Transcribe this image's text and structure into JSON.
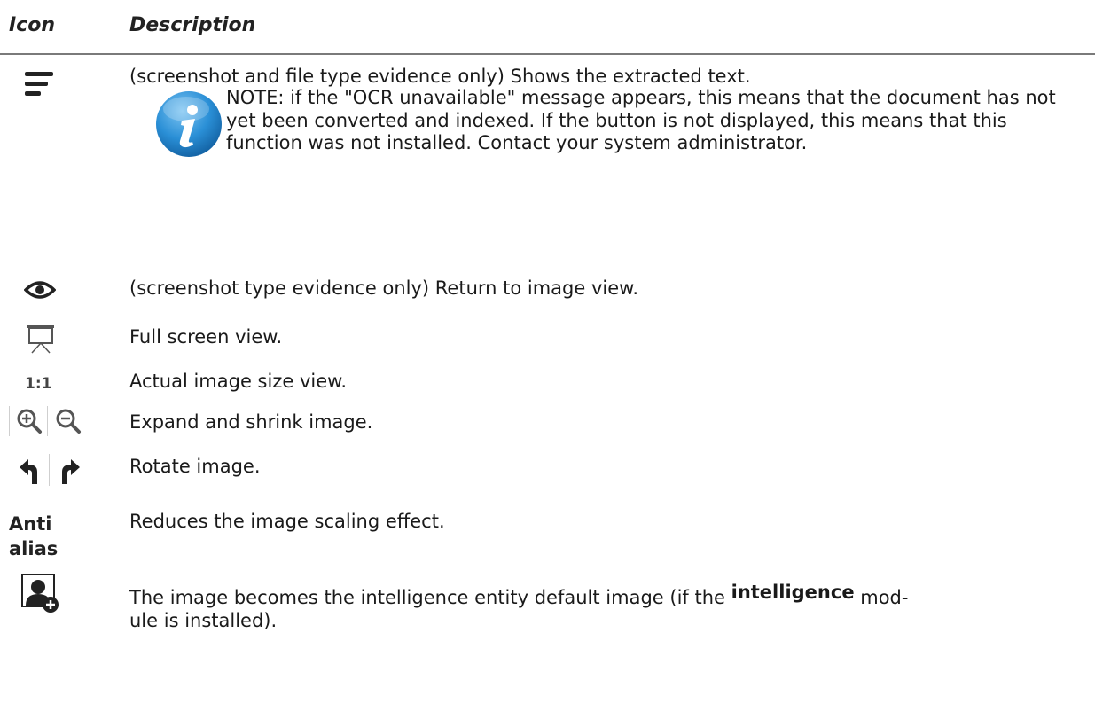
{
  "header": {
    "icon_col": "Icon",
    "desc_col": "Description"
  },
  "rows": {
    "text": {
      "icon": "text-lines-icon",
      "description": "(screenshot and file type evidence only) Shows the extracted text.",
      "note": "NOTE: if the \"OCR unavailable\" message appears, this means that the document has not yet been converted and indexed. If the button is not displayed, this means that this function was not installed. Contact your system administrator.",
      "note_icon": "info-icon"
    },
    "eye": {
      "icon": "eye-icon",
      "description": "(screenshot type evidence only) Return to image view."
    },
    "fullscreen": {
      "icon": "projector-screen-icon",
      "description": "Full screen view."
    },
    "actual": {
      "icon_text": "1:1",
      "description": "Actual image size view."
    },
    "zoom": {
      "icons": [
        "zoom-in-icon",
        "zoom-out-icon"
      ],
      "description": "Expand and shrink image."
    },
    "rotate": {
      "icons": [
        "rotate-left-icon",
        "rotate-right-icon"
      ],
      "description": "Rotate image."
    },
    "antialias": {
      "label_line1": "Anti",
      "label_line2": "alias",
      "description": "Reduces the image scaling effect."
    },
    "entity": {
      "icon": "user-add-icon",
      "description_part1": "The image becomes the intelligence entity default image (if the ",
      "description_bold": "intelligence",
      "description_part2": " mod-",
      "description_line2": "ule is installed)."
    }
  },
  "colors": {
    "text": "#1a1a1a",
    "rule": "#7a7a7a",
    "icon_dark": "#222222",
    "info_blue": "#2a8fd6"
  }
}
